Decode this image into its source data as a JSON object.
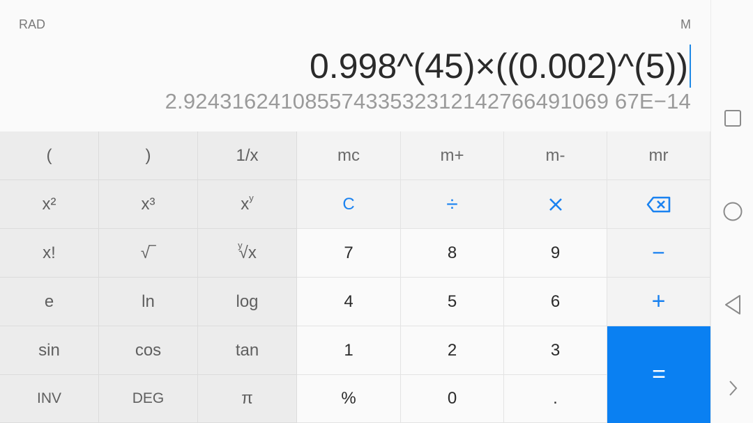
{
  "display": {
    "angle_mode": "RAD",
    "memory_indicator": "M",
    "expression": "0.998^(45)×((0.002)^(5))",
    "result": "2.92431624108557433532312142766491069 67E−14"
  },
  "keys": {
    "open_paren": "(",
    "close_paren": ")",
    "reciprocal": "1/x",
    "mc": "mc",
    "m_plus": "m+",
    "m_minus": "m-",
    "mr": "mr",
    "square_base": "x²",
    "cube_base": "x³",
    "power_base": "x",
    "power_exp": "y",
    "clear": "C",
    "divide": "÷",
    "factorial": "x!",
    "sqrt": "√‾",
    "yroot_index": "y",
    "yroot_body": "√x",
    "seven": "7",
    "eight": "8",
    "nine": "9",
    "minus": "−",
    "e": "e",
    "ln": "ln",
    "log": "log",
    "four": "4",
    "five": "5",
    "six": "6",
    "plus": "+",
    "sin": "sin",
    "cos": "cos",
    "tan": "tan",
    "one": "1",
    "two": "2",
    "three": "3",
    "equals": "=",
    "inv": "INV",
    "deg": "DEG",
    "pi": "π",
    "percent": "%",
    "zero": "0",
    "decimal": "."
  },
  "icons": {
    "multiply": "multiply-icon",
    "backspace": "backspace-icon",
    "nav_recent": "square-icon",
    "nav_home": "circle-icon",
    "nav_back": "triangle-back-icon",
    "nav_expand": "chevron-right-icon"
  },
  "colors": {
    "accent": "#1a82f0",
    "equals_bg": "#0a80f2"
  }
}
